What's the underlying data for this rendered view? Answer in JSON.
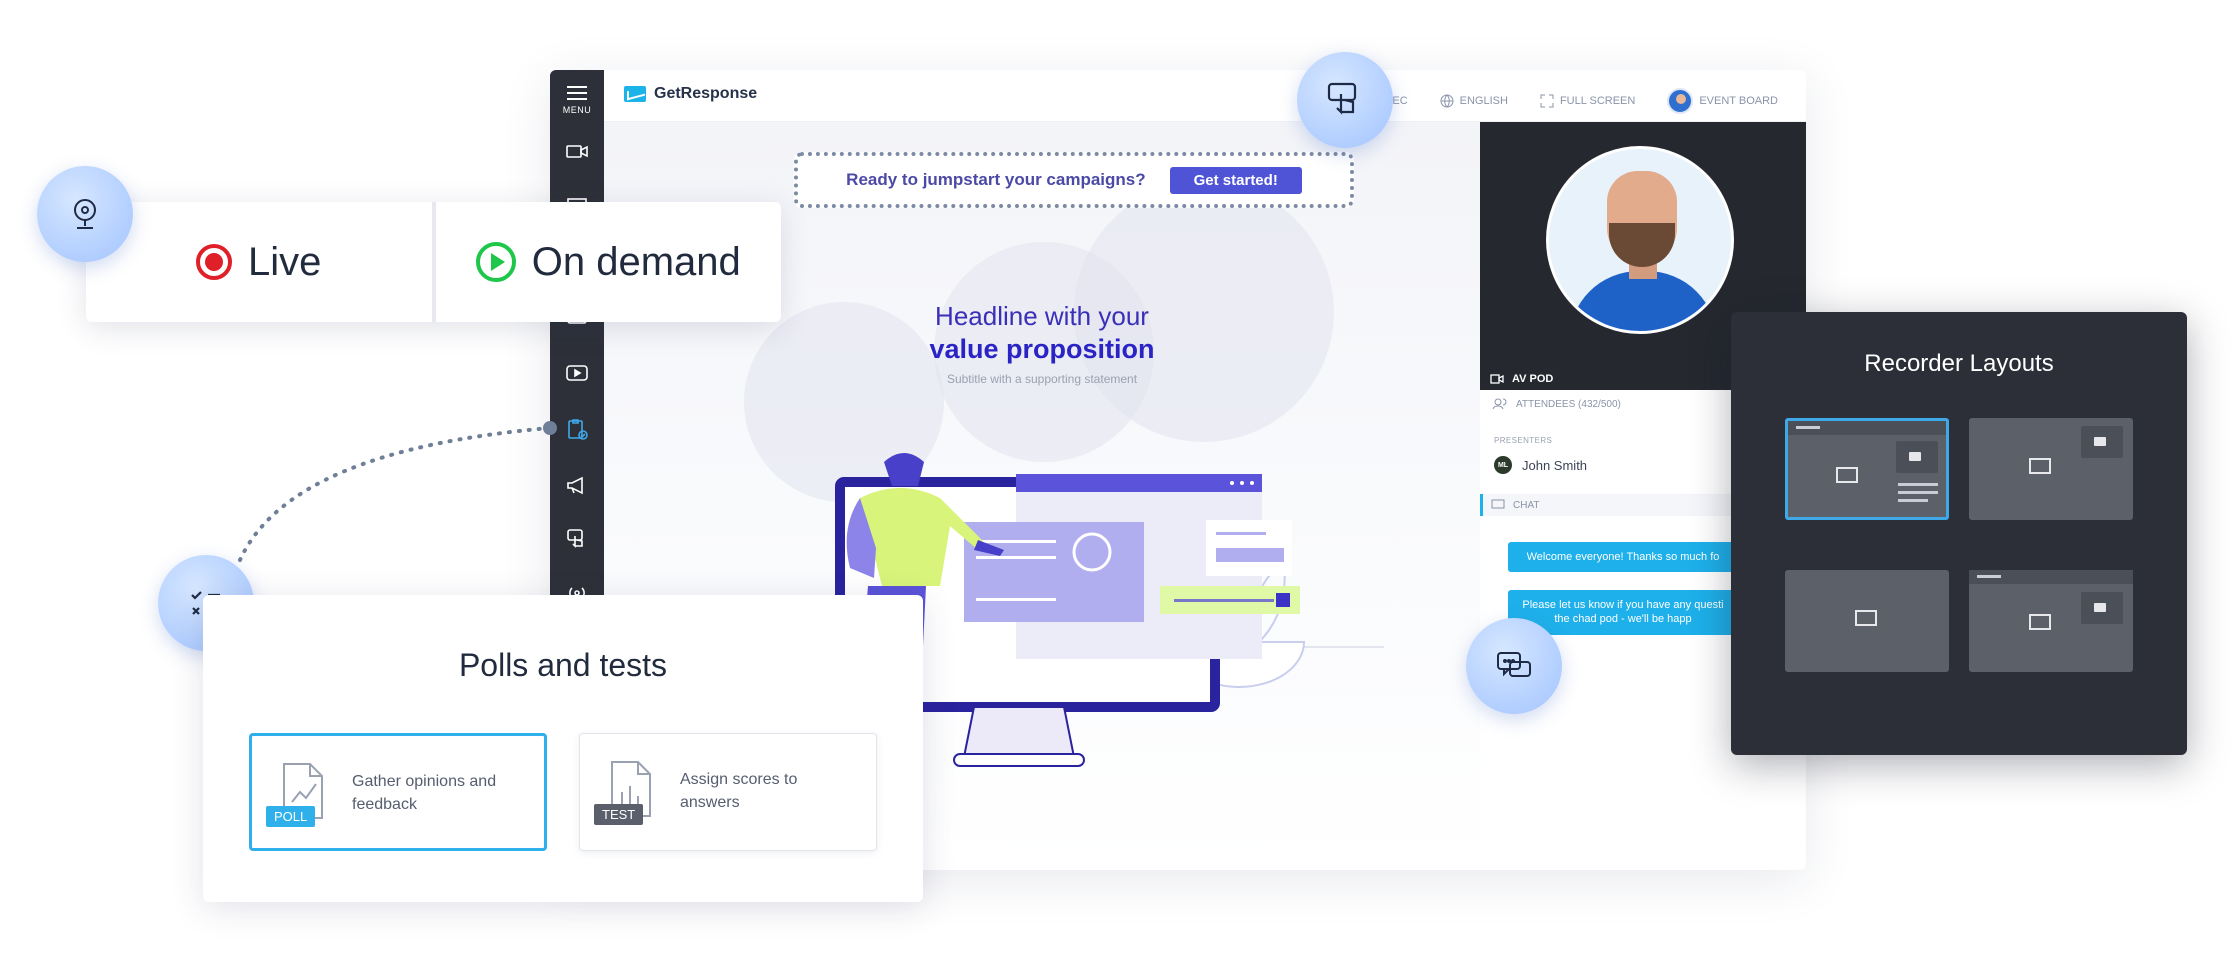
{
  "app": {
    "brand": "GetResponse",
    "sidebar": {
      "menu_label": "MENU"
    },
    "topbar": {
      "rec_label": "REC",
      "language_label": "ENGLISH",
      "fullscreen_label": "FULL SCREEN",
      "event_board_label": "EVENT BOARD"
    },
    "stage": {
      "cta_text": "Ready to jumpstart your campaigns?",
      "cta_button": "Get started!",
      "headline_line1": "Headline with your",
      "headline_line2": "value proposition",
      "subtitle": "Subtitle with a supporting statement"
    },
    "rightcol": {
      "av_pod_label": "AV POD",
      "attendees_label": "ATTENDEES (432/500)",
      "presenters_label": "PRESENTERS",
      "presenter_initials": "ML",
      "presenter_name": "John Smith",
      "chat_label": "CHAT",
      "messages": [
        "Welcome everyone! Thanks so much fo",
        "Please let us know if you have any questi the chad pod - we'll be happ"
      ]
    }
  },
  "modes": {
    "live_label": "Live",
    "on_demand_label": "On demand"
  },
  "polls": {
    "title": "Polls and tests",
    "options": [
      {
        "badge": "POLL",
        "text": "Gather opinions and feedback"
      },
      {
        "badge": "TEST",
        "text": "Assign scores to answers"
      }
    ]
  },
  "recorder": {
    "title": "Recorder Layouts",
    "selected_layout": 1
  },
  "colors": {
    "accent_blue": "#2fb0ea",
    "cta_purple": "#4f54d6",
    "live_red": "#e02028",
    "on_demand_green": "#1ec74a",
    "sidebar_dark": "#2d3038",
    "recorder_bg": "#2c2f37"
  },
  "icons": {
    "bubble_webcam": "webcam-icon",
    "bubble_touch": "touch-hand-icon",
    "bubble_poll": "checklist-icon",
    "bubble_chat": "chat-icon"
  }
}
